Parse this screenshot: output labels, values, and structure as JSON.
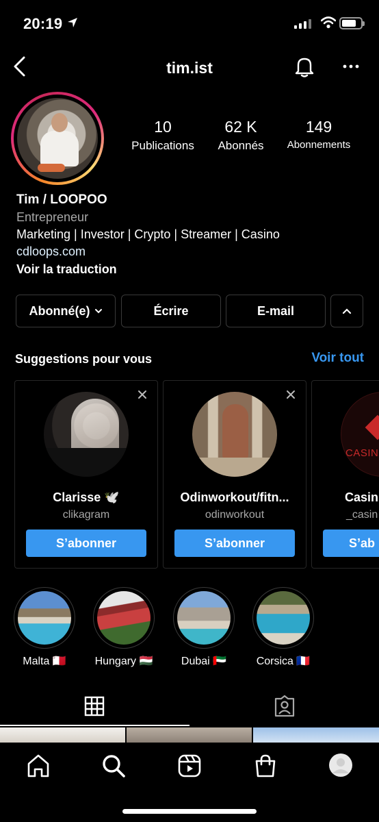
{
  "status_bar": {
    "time": "20:19",
    "battery_level": 0.75
  },
  "header": {
    "username": "tim.ist"
  },
  "profile": {
    "stats": [
      {
        "value": "10",
        "label": "Publications"
      },
      {
        "value": "62 K",
        "label": "Abonnés"
      },
      {
        "value": "149",
        "label": "Abonnements"
      }
    ],
    "name": "Tim / LOOPOO",
    "category": "Entrepreneur",
    "bio": "Marketing | Investor | Crypto | Streamer | Casino",
    "link": "cdloops.com",
    "translate": "Voir la traduction"
  },
  "actions": {
    "following": "Abonné(e)",
    "message": "Écrire",
    "email": "E-mail"
  },
  "suggestions": {
    "title": "Suggestions pour vous",
    "see_all": "Voir tout",
    "follow_label": "S’abonner",
    "cards": [
      {
        "name": "Clarisse 🕊️",
        "handle": "clikagram"
      },
      {
        "name": "Odinworkout/fitn...",
        "handle": "odinworkout"
      },
      {
        "name": "Casin",
        "handle": "_casin",
        "follow": "S’ab",
        "photo_text": "CASIN"
      }
    ]
  },
  "highlights": [
    {
      "label": "Malta 🇲🇹"
    },
    {
      "label": "Hungary 🇭🇺"
    },
    {
      "label": "Dubai 🇦🇪"
    },
    {
      "label": "Corsica 🇫🇷"
    }
  ],
  "colors": {
    "accent": "#3897f0",
    "background": "#000000",
    "border": "#3a3a3a",
    "secondary_text": "#a8a8a8"
  }
}
